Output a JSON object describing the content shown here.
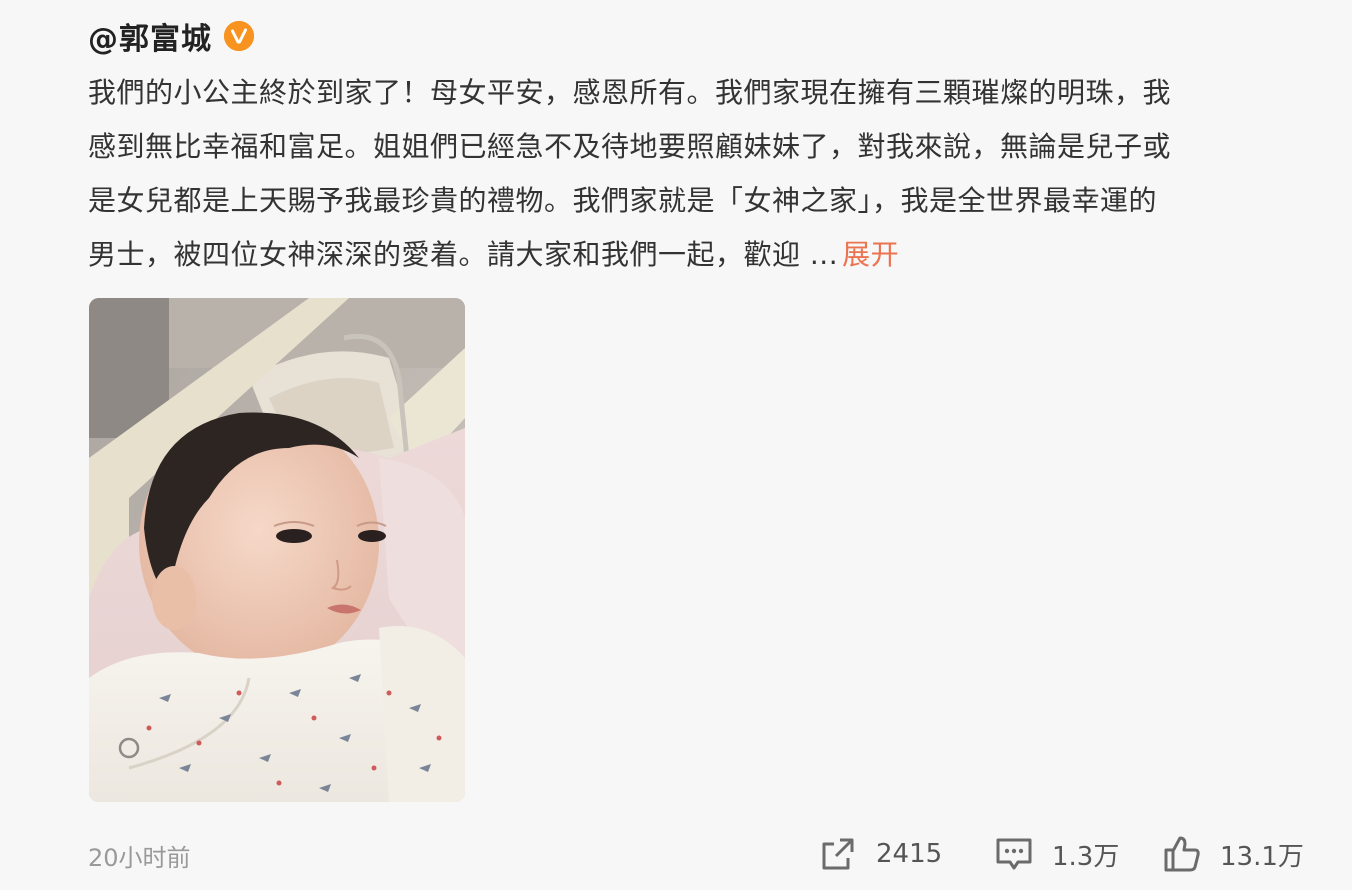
{
  "post": {
    "author": "@郭富城",
    "verified_icon": "verified-badge-icon",
    "verified_color": "#f7931e",
    "content_lines": [
      "我們的小公主終於到家了！母女平安，感恩所有。我們家現在擁有三顆璀燦的明珠，我",
      "感到無比幸福和富足。姐姐們已經急不及待地要照顧妹妹了，對我來說，無論是兒子或",
      "是女兒都是上天賜予我最珍貴的禮物。我們家就是「女神之家」，我是全世界最幸運的",
      "男士，被四位女神深深的愛着。請大家和我們一起，歡迎  ..."
    ],
    "expand_label": "展开",
    "expand_color": "#eb7350",
    "image_alt": "newborn-baby-photo",
    "time": "20小时前",
    "actions": {
      "repost": {
        "icon": "share-icon",
        "count": "2415"
      },
      "comment": {
        "icon": "comment-icon",
        "count": "1.3万"
      },
      "like": {
        "icon": "thumbs-up-icon",
        "count": "13.1万"
      }
    }
  }
}
